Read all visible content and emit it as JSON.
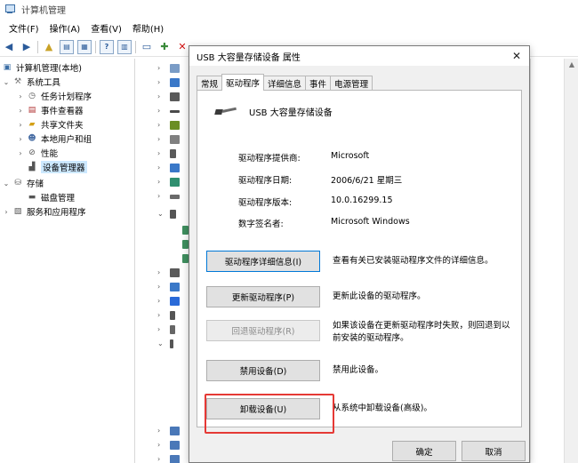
{
  "window": {
    "title": "计算机管理"
  },
  "menu": [
    "文件(F)",
    "操作(A)",
    "查看(V)",
    "帮助(H)"
  ],
  "tree": {
    "root": "计算机管理(本地)",
    "system_tools": "系统工具",
    "task_scheduler": "任务计划程序",
    "event_viewer": "事件查看器",
    "shared_folders": "共享文件夹",
    "local_users": "本地用户和组",
    "performance": "性能",
    "device_manager": "设备管理器",
    "storage": "存储",
    "disk_management": "磁盘管理",
    "services": "服务和应用程序"
  },
  "dialog": {
    "title": "USB 大容量存储设备 属性",
    "tabs": [
      "常规",
      "驱动程序",
      "详细信息",
      "事件",
      "电源管理"
    ],
    "device_name": "USB 大容量存储设备",
    "props": [
      {
        "label": "驱动程序提供商:",
        "value": "Microsoft"
      },
      {
        "label": "驱动程序日期:",
        "value": "2006/6/21 星期三"
      },
      {
        "label": "驱动程序版本:",
        "value": "10.0.16299.15"
      },
      {
        "label": "数字签名者:",
        "value": "Microsoft Windows"
      }
    ],
    "actions": [
      {
        "label": "驱动程序详细信息(I)",
        "desc": "查看有关已安装驱动程序文件的详细信息。"
      },
      {
        "label": "更新驱动程序(P)",
        "desc": "更新此设备的驱动程序。"
      },
      {
        "label": "回退驱动程序(R)",
        "desc": "如果该设备在更新驱动程序时失败，则回退到以前安装的驱动程序。"
      },
      {
        "label": "禁用设备(D)",
        "desc": "禁用此设备。"
      },
      {
        "label": "卸载设备(U)",
        "desc": "从系统中卸载设备(高级)。"
      }
    ],
    "ok": "确定",
    "cancel": "取消"
  },
  "colors": {
    "accent": "#0078d7",
    "highlight": "#e53935",
    "selection": "#cce8ff"
  }
}
